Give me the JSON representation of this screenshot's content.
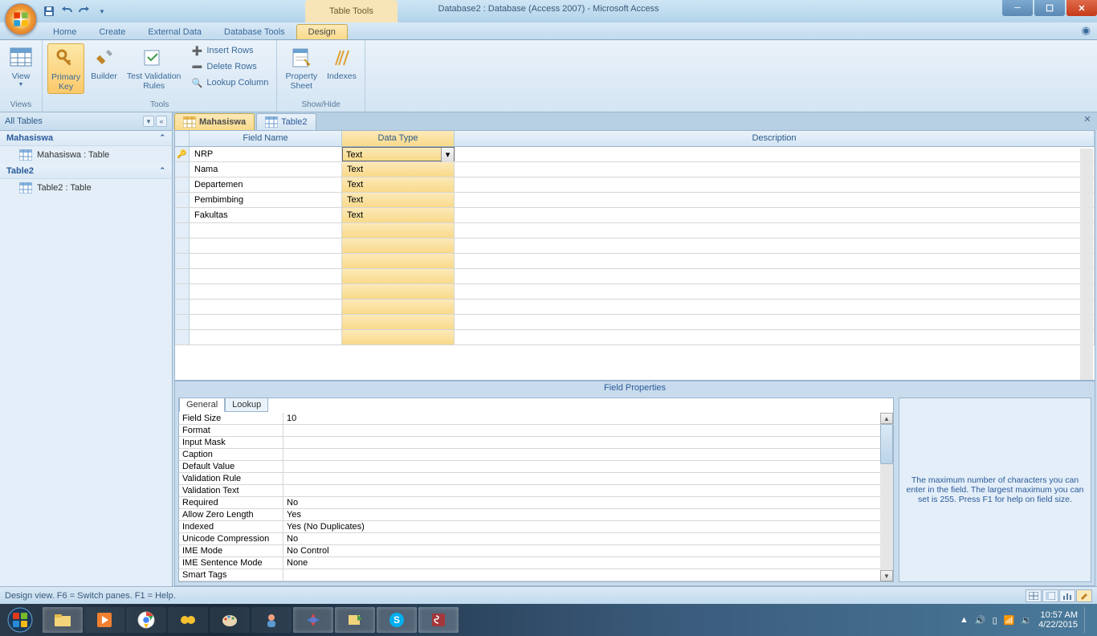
{
  "window": {
    "tools_tab": "Table Tools",
    "title": "Database2 : Database (Access 2007)  -  Microsoft Access"
  },
  "menu": {
    "tabs": [
      "Home",
      "Create",
      "External Data",
      "Database Tools",
      "Design"
    ],
    "active": "Design"
  },
  "ribbon": {
    "views": {
      "view": "View",
      "group": "Views"
    },
    "tools": {
      "primary_key": "Primary\nKey",
      "builder": "Builder",
      "tvr": "Test Validation\nRules",
      "insert": "Insert Rows",
      "delete": "Delete Rows",
      "lookup": "Lookup Column",
      "group": "Tools"
    },
    "showhide": {
      "property": "Property\nSheet",
      "indexes": "Indexes",
      "group": "Show/Hide"
    }
  },
  "nav": {
    "header": "All Tables",
    "groups": [
      {
        "name": "Mahasiswa",
        "items": [
          "Mahasiswa : Table"
        ]
      },
      {
        "name": "Table2",
        "items": [
          "Table2 : Table"
        ]
      }
    ]
  },
  "doc": {
    "tabs": [
      "Mahasiswa",
      "Table2"
    ],
    "active": "Mahasiswa",
    "headers": {
      "field": "Field Name",
      "type": "Data Type",
      "desc": "Description"
    },
    "rows": [
      {
        "pk": true,
        "name": "NRP",
        "type": "Text"
      },
      {
        "pk": false,
        "name": "Nama",
        "type": "Text"
      },
      {
        "pk": false,
        "name": "Departemen",
        "type": "Text"
      },
      {
        "pk": false,
        "name": "Pembimbing",
        "type": "Text"
      },
      {
        "pk": false,
        "name": "Fakultas",
        "type": "Text"
      }
    ]
  },
  "fp": {
    "title": "Field Properties",
    "tabs": [
      "General",
      "Lookup"
    ],
    "rows": [
      {
        "label": "Field Size",
        "value": "10"
      },
      {
        "label": "Format",
        "value": ""
      },
      {
        "label": "Input Mask",
        "value": ""
      },
      {
        "label": "Caption",
        "value": ""
      },
      {
        "label": "Default Value",
        "value": ""
      },
      {
        "label": "Validation Rule",
        "value": ""
      },
      {
        "label": "Validation Text",
        "value": ""
      },
      {
        "label": "Required",
        "value": "No"
      },
      {
        "label": "Allow Zero Length",
        "value": "Yes"
      },
      {
        "label": "Indexed",
        "value": "Yes (No Duplicates)"
      },
      {
        "label": "Unicode Compression",
        "value": "No"
      },
      {
        "label": "IME Mode",
        "value": "No Control"
      },
      {
        "label": "IME Sentence Mode",
        "value": "None"
      },
      {
        "label": "Smart Tags",
        "value": ""
      }
    ],
    "help": "The maximum number of characters you can enter in the field.  The largest maximum you can set is 255.  Press F1 for help on field size."
  },
  "status": "Design view.   F6 = Switch panes.   F1 = Help.",
  "tray": {
    "time": "10:57 AM",
    "date": "4/22/2015"
  }
}
